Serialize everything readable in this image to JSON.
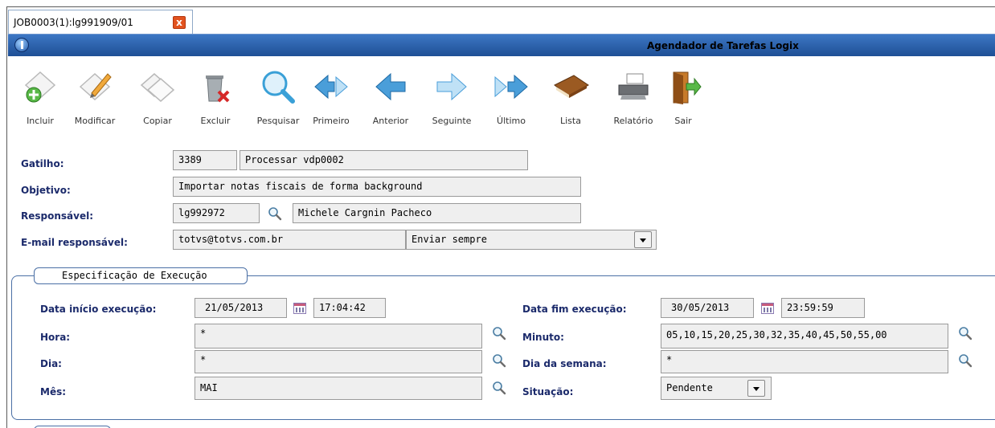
{
  "tab": {
    "title": "JOB0003(1):lg991909/01",
    "close_label": "x"
  },
  "window": {
    "title": "Agendador de Tarefas Logix"
  },
  "toolbar": {
    "buttons": [
      {
        "label": "Incluir",
        "icon": "add-icon"
      },
      {
        "label": "Modificar",
        "icon": "edit-icon"
      },
      {
        "label": "Copiar",
        "icon": "copy-icon"
      },
      {
        "label": "Excluir",
        "icon": "delete-icon"
      },
      {
        "label": "Pesquisar",
        "icon": "search-icon"
      },
      {
        "label": "Primeiro",
        "icon": "first-icon"
      },
      {
        "label": "Anterior",
        "icon": "previous-icon"
      },
      {
        "label": "Seguinte",
        "icon": "next-icon"
      },
      {
        "label": "Último",
        "icon": "last-icon"
      },
      {
        "label": "Lista",
        "icon": "list-icon"
      },
      {
        "label": "Relatório",
        "icon": "printer-icon"
      },
      {
        "label": "Sair",
        "icon": "exit-icon"
      }
    ]
  },
  "form": {
    "gatilho": {
      "label": "Gatilho:",
      "code": "3389",
      "desc": "Processar vdp0002"
    },
    "objetivo": {
      "label": "Objetivo:",
      "value": "Importar notas fiscais de forma background"
    },
    "responsavel": {
      "label": "Responsável:",
      "code": "lg992972",
      "name": "Michele Cargnin Pacheco"
    },
    "email": {
      "label": "E-mail responsável:",
      "value": "totvs@totvs.com.br",
      "option": "Enviar sempre"
    }
  },
  "execucao": {
    "title": "Especificação de Execução",
    "data_inicio": {
      "label": "Data início execução:",
      "date": "21/05/2013",
      "time": "17:04:42"
    },
    "data_fim": {
      "label": "Data fim execução:",
      "date": "30/05/2013",
      "time": "23:59:59"
    },
    "hora": {
      "label": "Hora:",
      "value": "*"
    },
    "minuto": {
      "label": "Minuto:",
      "value": "05,10,15,20,25,30,32,35,40,45,50,55,00"
    },
    "dia": {
      "label": "Dia:",
      "value": "*"
    },
    "dia_semana": {
      "label": "Dia da semana:",
      "value": "*"
    },
    "mes": {
      "label": "Mês:",
      "value": "MAI"
    },
    "situacao": {
      "label": "Situação:",
      "value": "Pendente"
    }
  },
  "colors": {
    "titlebar": "#2a5fae",
    "label": "#1b2a6b",
    "accent_close": "#e2531f"
  }
}
